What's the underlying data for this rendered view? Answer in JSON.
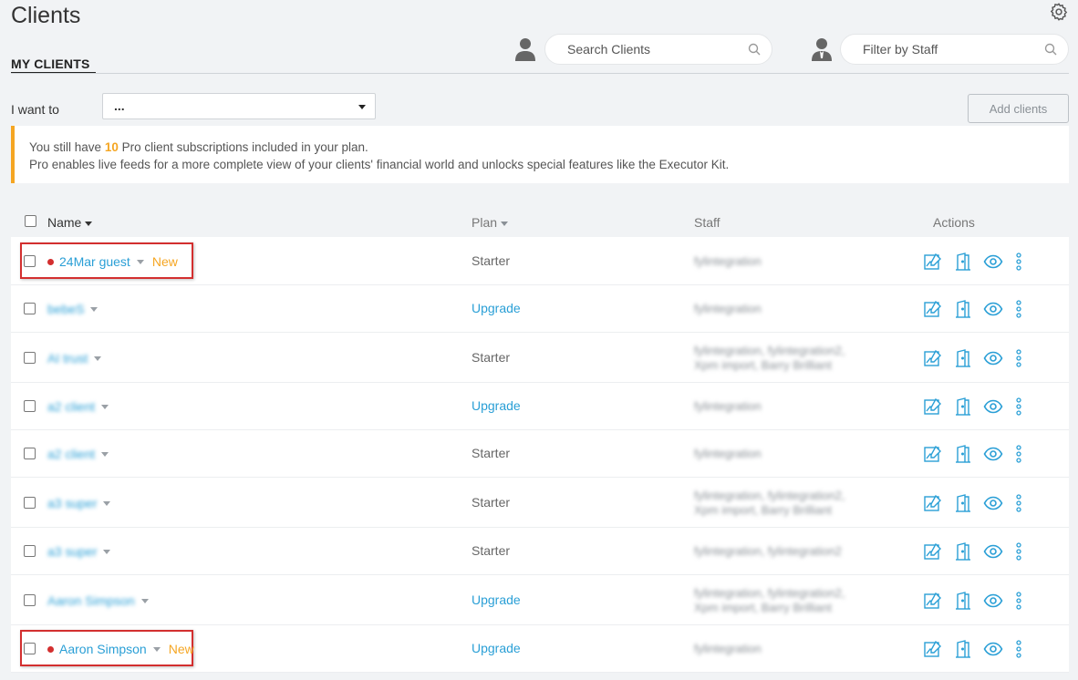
{
  "page": {
    "title": "Clients"
  },
  "tabs": {
    "my_clients": "MY CLIENTS"
  },
  "search": {
    "clients_placeholder": "Search Clients",
    "staff_placeholder": "Filter by Staff"
  },
  "toolbar": {
    "i_want_to": "I want to",
    "select_value": "...",
    "add_clients": "Add clients"
  },
  "notice": {
    "line1_pre": "You still have ",
    "count": "10",
    "line1_post": " Pro client subscriptions included in your plan.",
    "line2": "Pro enables live feeds for a more complete view of your clients' financial world and unlocks special features like the Executor Kit."
  },
  "table": {
    "headers": {
      "name": "Name",
      "plan": "Plan",
      "staff": "Staff",
      "actions": "Actions"
    },
    "rows": [
      {
        "name": "24Mar guest",
        "new": "New",
        "plan": "Starter",
        "staff1": "fylintegration",
        "staff2": ""
      },
      {
        "name": "bebeS",
        "new": "",
        "plan": "Upgrade",
        "staff1": "fylintegration",
        "staff2": ""
      },
      {
        "name": "AI trust",
        "new": "",
        "plan": "Starter",
        "staff1": "fylintegration, fylintegration2,",
        "staff2": "Xpm import, Barry Brilliant"
      },
      {
        "name": "a2 client",
        "new": "",
        "plan": "Upgrade",
        "staff1": "fylintegration",
        "staff2": ""
      },
      {
        "name": "a2 client",
        "new": "",
        "plan": "Starter",
        "staff1": "fylintegration",
        "staff2": ""
      },
      {
        "name": "a3 super",
        "new": "",
        "plan": "Starter",
        "staff1": "fylintegration, fylintegration2,",
        "staff2": "Xpm import, Barry Brilliant"
      },
      {
        "name": "a3 super",
        "new": "",
        "plan": "Starter",
        "staff1": "fylintegration, fylintegration2",
        "staff2": ""
      },
      {
        "name": "Aaron Simpson",
        "new": "",
        "plan": "Upgrade",
        "staff1": "fylintegration, fylintegration2,",
        "staff2": "Xpm import, Barry Brilliant"
      },
      {
        "name": "Aaron Simpson",
        "new": "New",
        "plan": "Upgrade",
        "staff1": "fylintegration",
        "staff2": ""
      }
    ]
  },
  "colors": {
    "accent": "#2a9fd6",
    "warning": "#f5a623",
    "danger": "#d32f2f"
  }
}
